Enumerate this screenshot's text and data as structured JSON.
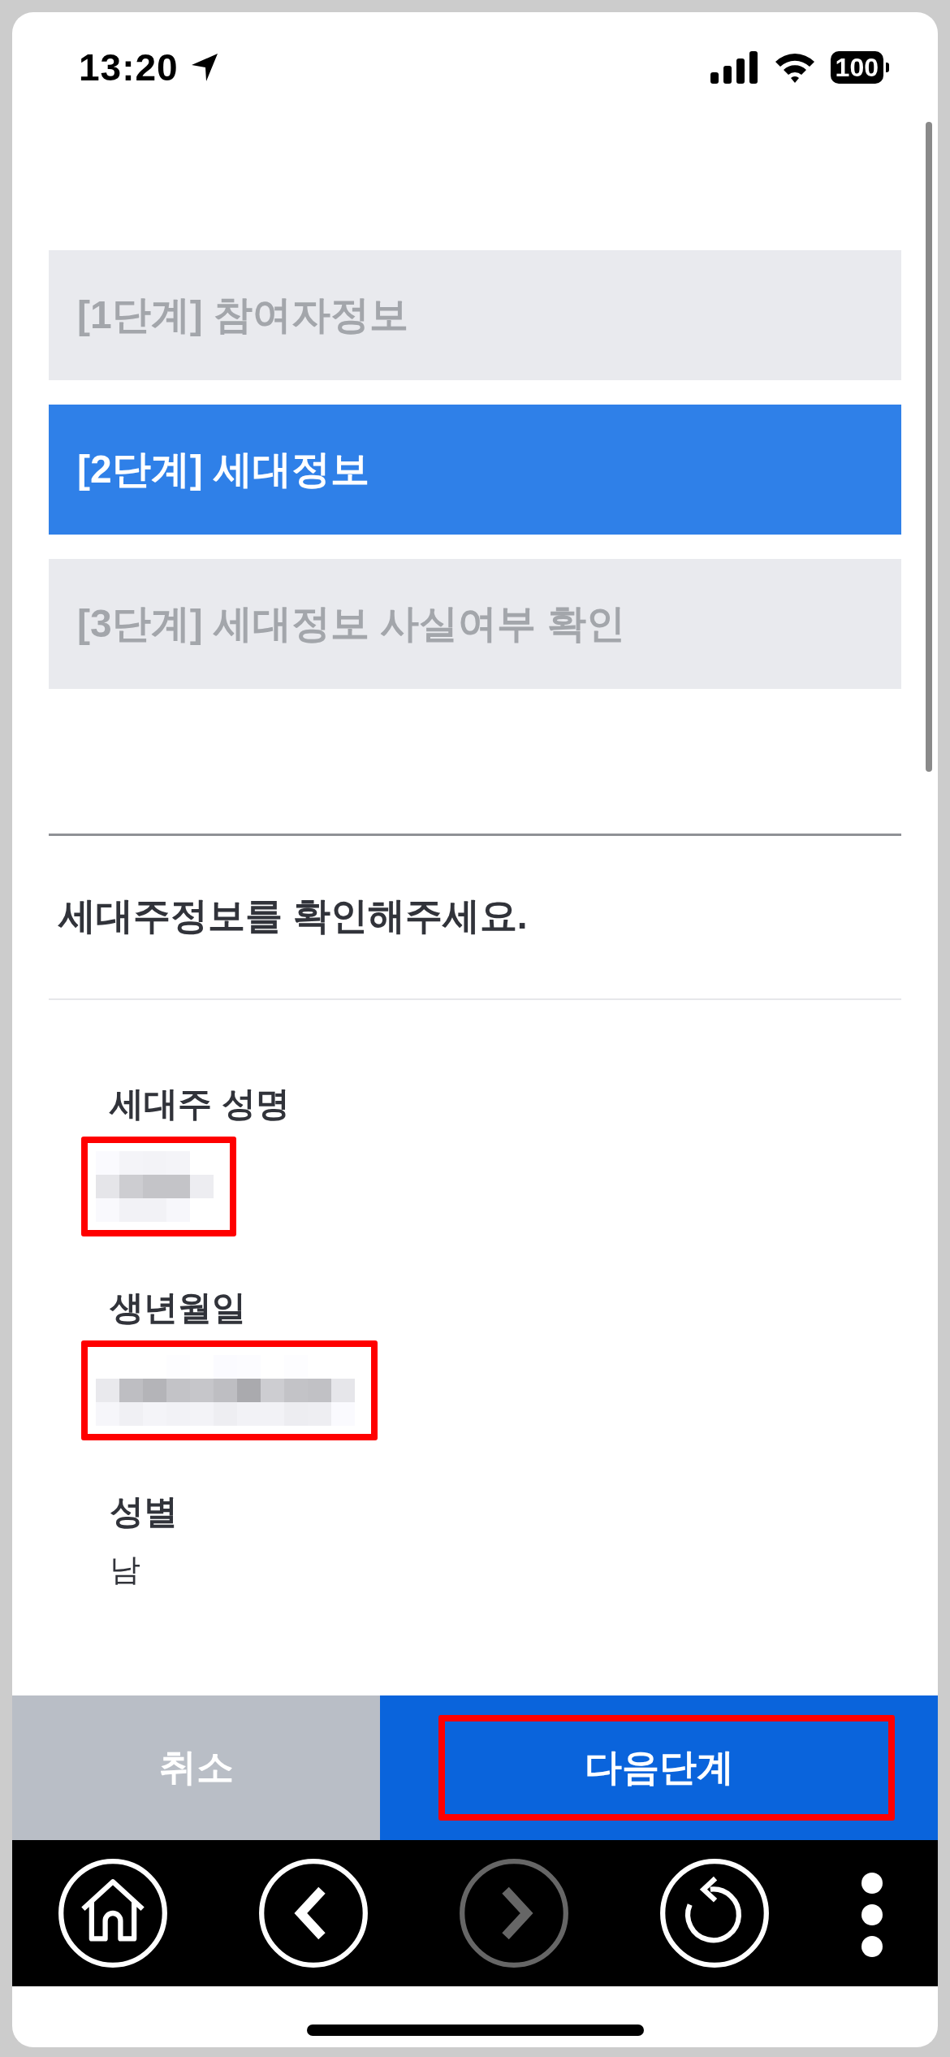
{
  "status_bar": {
    "time": "13:20",
    "battery": "100"
  },
  "steps": [
    {
      "label": "[1단계] 참여자정보",
      "selected": false
    },
    {
      "label": "[2단계] 세대정보",
      "selected": true
    },
    {
      "label": "[3단계] 세대정보 사실여부 확인",
      "selected": false
    }
  ],
  "section": {
    "heading": "세대주정보를 확인해주세요."
  },
  "fields": [
    {
      "label": "세대주 성명",
      "kind": "redacted",
      "highlighted": true
    },
    {
      "label": "생년월일",
      "kind": "redacted",
      "highlighted": true
    },
    {
      "label": "성별",
      "kind": "text",
      "value": "남",
      "highlighted": false
    }
  ],
  "actions": [
    {
      "label": "취소",
      "kind": "secondary",
      "highlighted": false
    },
    {
      "label": "다음단계",
      "kind": "primary",
      "highlighted": true
    }
  ],
  "nav": [
    {
      "kind": "home",
      "disabled": false
    },
    {
      "kind": "back",
      "disabled": false
    },
    {
      "kind": "forward",
      "disabled": true
    },
    {
      "kind": "reload",
      "disabled": false
    },
    {
      "kind": "more",
      "disabled": false
    }
  ]
}
